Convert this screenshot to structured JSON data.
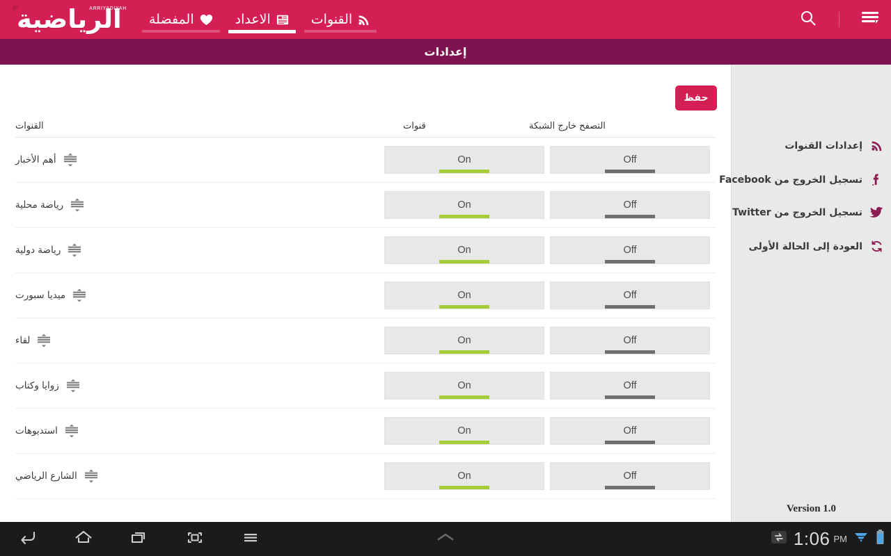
{
  "header": {
    "logo_arabic": "الرياضية",
    "logo_latin": "ARRIYADIYAH",
    "tabs": [
      {
        "label": "القنوات",
        "icon": "rss-icon",
        "active": false
      },
      {
        "label": "الاعداد",
        "icon": "newspaper-icon",
        "active": true
      },
      {
        "label": "المفضلة",
        "icon": "heart-icon",
        "active": false
      }
    ],
    "search_icon": "search-icon",
    "menu_icon": "hamburger-menu-icon",
    "brand_color": "#d41f54"
  },
  "title_bar": {
    "title": "إعدادات",
    "color": "#7d1450"
  },
  "toolbar": {
    "save_label": "حفظ"
  },
  "table": {
    "headers": {
      "channels": "القنوات",
      "col1": "قنوات",
      "col2": "التصفح خارج الشبكة"
    },
    "rows": [
      {
        "name": "أهم الأخبار",
        "col1": "On",
        "col1_state": "on",
        "col2": "Off",
        "col2_state": "off"
      },
      {
        "name": "رياضة محلية",
        "col1": "On",
        "col1_state": "on",
        "col2": "Off",
        "col2_state": "off"
      },
      {
        "name": "رياضة دولية",
        "col1": "On",
        "col1_state": "on",
        "col2": "Off",
        "col2_state": "off"
      },
      {
        "name": "ميديا سبورت",
        "col1": "On",
        "col1_state": "on",
        "col2": "Off",
        "col2_state": "off"
      },
      {
        "name": "لقاء",
        "col1": "On",
        "col1_state": "on",
        "col2": "Off",
        "col2_state": "off"
      },
      {
        "name": "زوايا وكتاب",
        "col1": "On",
        "col1_state": "on",
        "col2": "Off",
        "col2_state": "off"
      },
      {
        "name": "استديوهات",
        "col1": "On",
        "col1_state": "on",
        "col2": "Off",
        "col2_state": "off"
      },
      {
        "name": "الشارع الرياضي",
        "col1": "On",
        "col1_state": "on",
        "col2": "Off",
        "col2_state": "off"
      }
    ],
    "on_color": "#a4cd39",
    "off_color": "#6e6e6e"
  },
  "sidebar": {
    "items": [
      {
        "label": "إعدادات القنوات",
        "icon": "rss-icon"
      },
      {
        "label": "تسجيل الخروج من Facebook",
        "icon": "facebook-icon"
      },
      {
        "label": "تسجيل الخروج من Twitter",
        "icon": "twitter-icon"
      },
      {
        "label": "العودة إلى الحالة الأولى",
        "icon": "refresh-icon"
      }
    ],
    "version": "Version 1.0",
    "icon_color": "#8c1d52"
  },
  "system_bar": {
    "buttons": [
      "back-icon",
      "home-icon",
      "recents-icon",
      "screenshot-icon",
      "menu-icon"
    ],
    "expand_icon": "chevron-up-icon",
    "sync_icon": "sync-status-icon",
    "time": "1:06",
    "ampm": "PM",
    "wifi_icon": "wifi-icon",
    "battery_icon": "battery-icon"
  }
}
